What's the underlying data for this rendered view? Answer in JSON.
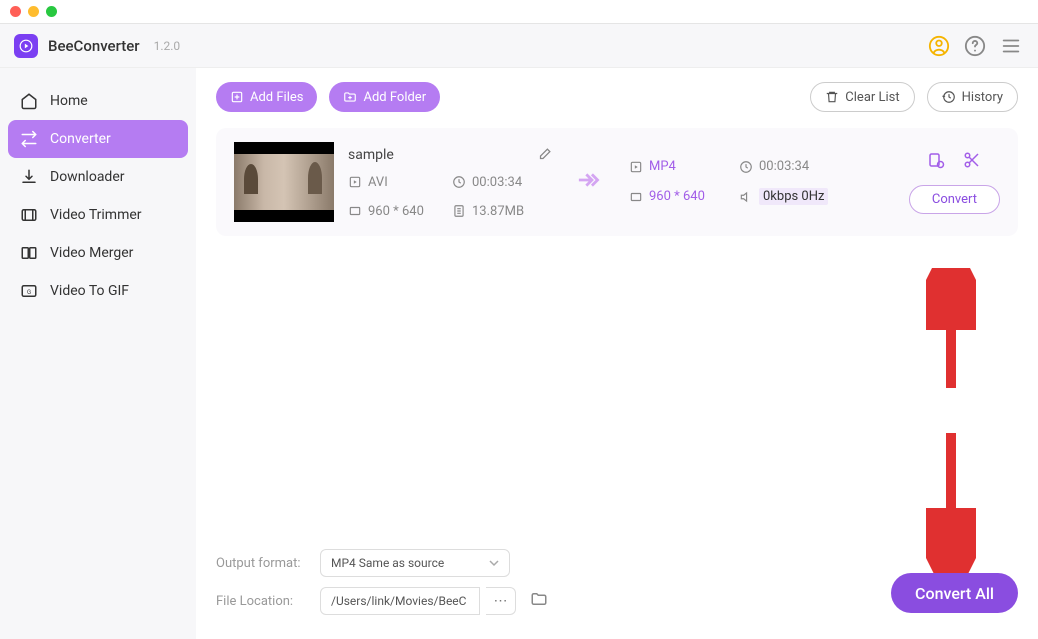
{
  "app": {
    "name": "BeeConverter",
    "version": "1.2.0"
  },
  "sidebar": {
    "items": [
      {
        "label": "Home"
      },
      {
        "label": "Converter"
      },
      {
        "label": "Downloader"
      },
      {
        "label": "Video Trimmer"
      },
      {
        "label": "Video Merger"
      },
      {
        "label": "Video To GIF"
      }
    ],
    "active_index": 1
  },
  "toolbar": {
    "add_files": "Add Files",
    "add_folder": "Add Folder",
    "clear_list": "Clear List",
    "history": "History"
  },
  "item": {
    "name": "sample",
    "source": {
      "format": "AVI",
      "duration": "00:03:34",
      "resolution": "960 * 640",
      "size": "13.87MB"
    },
    "target": {
      "format": "MP4",
      "duration": "00:03:34",
      "resolution": "960 * 640",
      "audio": "0kbps 0Hz"
    },
    "convert_label": "Convert"
  },
  "bottom": {
    "output_format_label": "Output format:",
    "output_format_value": "MP4 Same as source",
    "file_location_label": "File Location:",
    "file_location_value": "/Users/link/Movies/BeeC"
  },
  "convert_all": "Convert All"
}
